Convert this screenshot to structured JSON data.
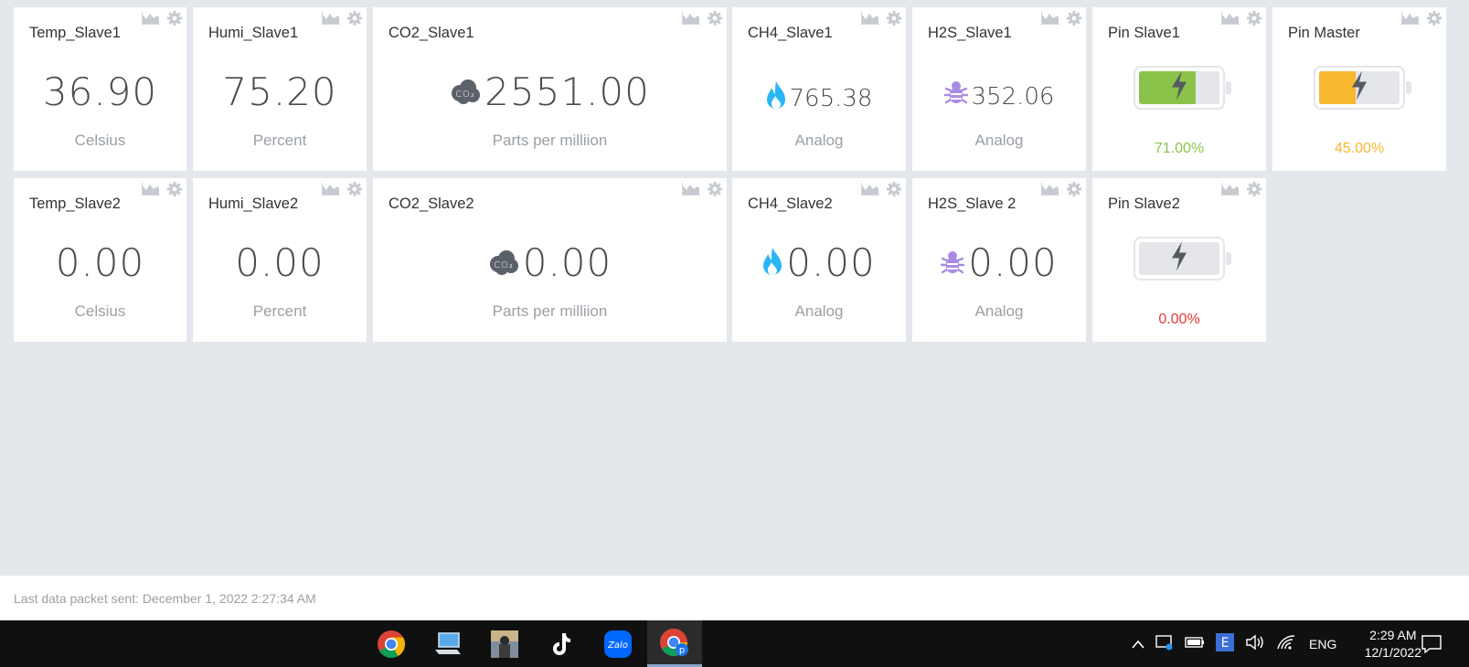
{
  "row1": [
    {
      "title": "Temp_Slave1",
      "value": "36.90",
      "unit": "Celsius"
    },
    {
      "title": "Humi_Slave1",
      "value": "75.20",
      "unit": "Percent"
    },
    {
      "title": "CO2_Slave1",
      "value": "2551.00",
      "unit": "Parts per milliion"
    },
    {
      "title": "CH4_Slave1",
      "value": "765.38",
      "unit": "Analog"
    },
    {
      "title": "H2S_Slave1",
      "value": "352.06",
      "unit": "Analog"
    },
    {
      "title": "Pin Slave1",
      "percent": "71.00%",
      "level": 0.71,
      "color": "#8bc34a"
    },
    {
      "title": "Pin Master",
      "percent": "45.00%",
      "level": 0.45,
      "color": "#f7b731"
    }
  ],
  "row2": [
    {
      "title": "Temp_Slave2",
      "value": "0.00",
      "unit": "Celsius"
    },
    {
      "title": "Humi_Slave2",
      "value": "0.00",
      "unit": "Percent"
    },
    {
      "title": "CO2_Slave2",
      "value": "0.00",
      "unit": "Parts per milliion"
    },
    {
      "title": "CH4_Slave2",
      "value": "0.00",
      "unit": "Analog"
    },
    {
      "title": "H2S_Slave 2",
      "value": "0.00",
      "unit": "Analog"
    },
    {
      "title": "Pin Slave2",
      "percent": "0.00%",
      "level": 0.0,
      "color": "#e53935"
    }
  ],
  "co2_icon_text": "CO₂",
  "footer": {
    "text": "Last data packet sent: December 1, 2022 2:27:34 AM"
  },
  "taskbar": {
    "apps": [
      "chrome-icon",
      "this-pc-icon",
      "game-icon",
      "tiktok-icon",
      "zalo-icon",
      "chrome-profile-icon"
    ],
    "zalo_label": "Zalo",
    "profile_badge": "p",
    "lang": "ENG",
    "time": "2:29 AM",
    "date": "12/1/2022"
  },
  "colors": {
    "flame": "#29b6f6",
    "bug": "#a98be3",
    "icon_gray": "#c7cbd1",
    "co2_cloud": "#5b6168"
  }
}
